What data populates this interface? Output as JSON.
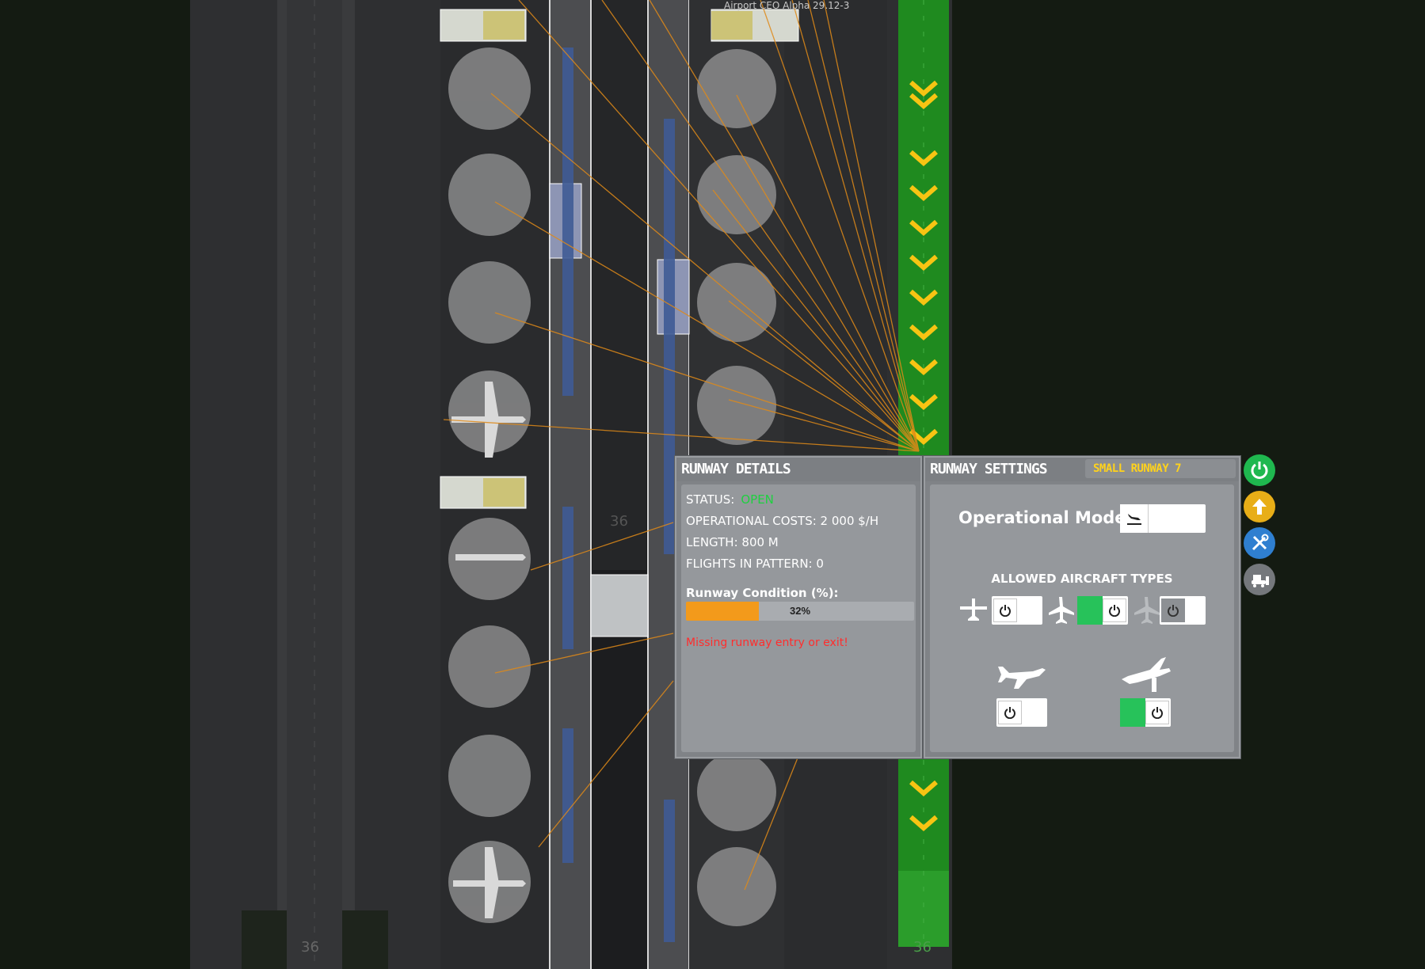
{
  "map": {
    "version_label": "Airport CEO Alpha 29.12-3"
  },
  "details": {
    "title": "Runway Details",
    "status_label": "STATUS:",
    "status_value": "OPEN",
    "costs": "OPERATIONAL COSTS: 2 000 $/H",
    "length": "LENGTH: 800 M",
    "flights": "FLIGHTS IN PATTERN: 0",
    "condition_label": "Runway Condition (%):",
    "condition_value": 0.32,
    "condition_text": "32%",
    "warning": "Missing runway entry or exit!"
  },
  "settings": {
    "title": "Runway Settings",
    "tag": "SMALL RUNWAY 7",
    "operational_mode_label": "Operational Mode:",
    "allowed_label": "ALLOWED AIRCRAFT TYPES",
    "toggles": {
      "mode": "off",
      "small": "off",
      "medium": "on",
      "large": "off",
      "departures": "off",
      "arrivals": "on"
    }
  },
  "colors": {
    "accent_green": "#27c25a",
    "status_open": "#1fd040",
    "condition_bar": "#f39a1b",
    "warning": "#ff2d2d",
    "tag_yellow": "#ffd21c"
  },
  "side_buttons": [
    "power-icon",
    "arrow-up-icon",
    "tools-icon",
    "bulldozer-icon"
  ]
}
